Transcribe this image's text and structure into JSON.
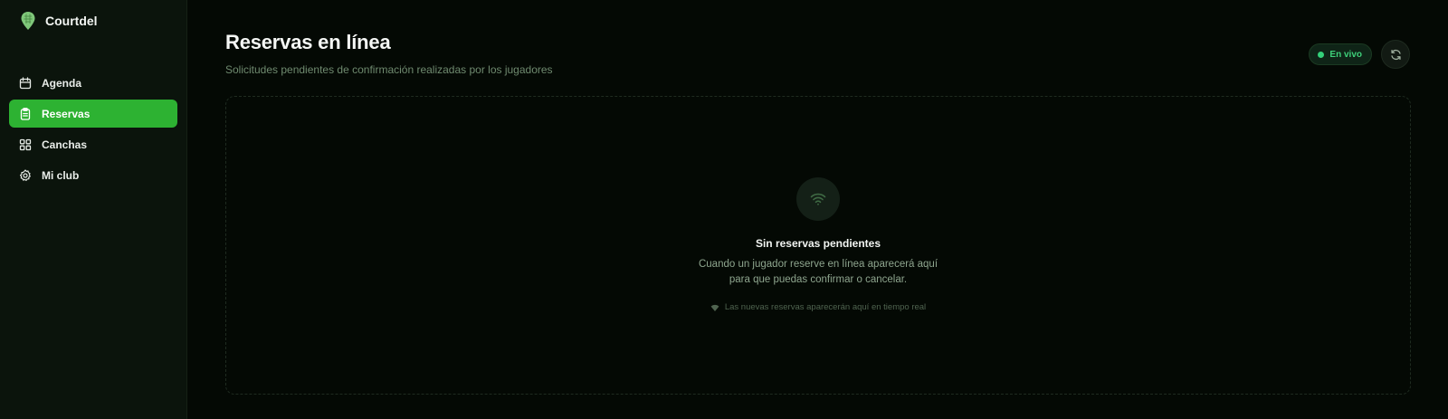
{
  "brand": {
    "name": "Courtdel",
    "logo_icon": "map-pin-icon",
    "accent": "#2db232"
  },
  "sidebar": {
    "items": [
      {
        "label": "Agenda",
        "icon": "calendar-icon",
        "active": false
      },
      {
        "label": "Reservas",
        "icon": "clipboard-icon",
        "active": true
      },
      {
        "label": "Canchas",
        "icon": "grid-icon",
        "active": false
      },
      {
        "label": "Mi club",
        "icon": "gear-icon",
        "active": false
      }
    ]
  },
  "header": {
    "title": "Reservas en línea",
    "subtitle": "Solicitudes pendientes de confirmación realizadas por los jugadores",
    "live_label": "En vivo",
    "live_color": "#34d17a",
    "refresh_icon": "refresh-icon"
  },
  "empty_state": {
    "icon": "wifi-icon",
    "title": "Sin reservas pendientes",
    "desc_line1": "Cuando un jugador reserve en línea aparecerá aquí",
    "desc_line2": "para que puedas confirmar o cancelar.",
    "hint": "Las nuevas reservas aparecerán aquí en tiempo real"
  }
}
